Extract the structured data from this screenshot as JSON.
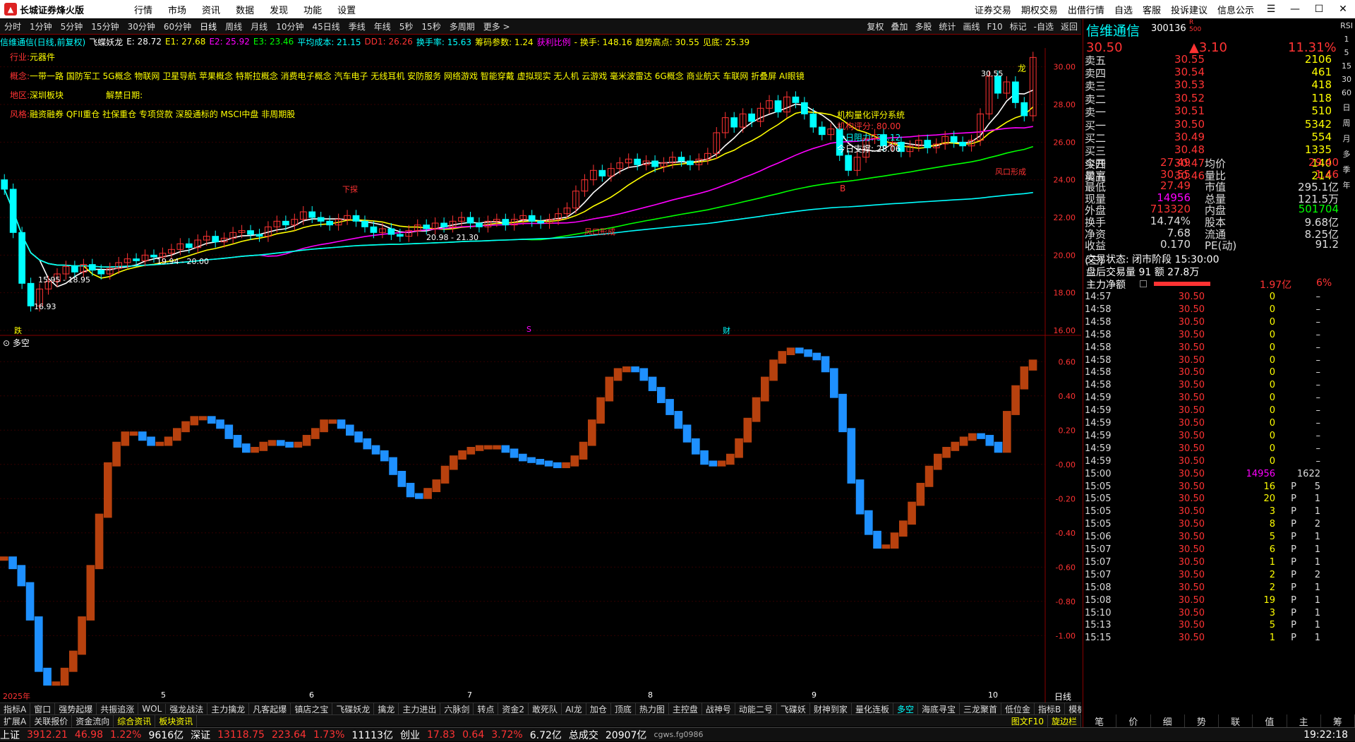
{
  "titlebar": {
    "app": "长城证券烽火版",
    "menus": [
      "行情",
      "市场",
      "资讯",
      "数据",
      "发现",
      "功能",
      "设置"
    ],
    "right": [
      "证券交易",
      "期权交易",
      "出借行情",
      "自选",
      "客服",
      "投诉建议",
      "信息公示"
    ]
  },
  "periods": [
    "分时",
    "1分钟",
    "5分钟",
    "15分钟",
    "30分钟",
    "60分钟",
    "日线",
    "周线",
    "月线",
    "10分钟",
    "45日线",
    "季线",
    "年线",
    "5秒",
    "15秒",
    "多周期",
    "更多 >"
  ],
  "toolbar_right": [
    "复权",
    "叠加",
    "多股",
    "统计",
    "画线",
    "F10",
    "标记",
    "-自选",
    "返回"
  ],
  "indicator_line": [
    {
      "t": "信维通信(日线,前复权)",
      "c": "ccya"
    },
    {
      "t": "飞蝶妖龙",
      "c": "cwht"
    },
    {
      "t": "E: 28.72",
      "c": "cwht"
    },
    {
      "t": "E1: 27.68",
      "c": "cyel"
    },
    {
      "t": "E2: 25.92",
      "c": "cmag"
    },
    {
      "t": "E3: 23.46",
      "c": "cgrn"
    },
    {
      "t": "平均成本: 21.15",
      "c": "ccya"
    },
    {
      "t": "DD1: 26.26",
      "c": "cred"
    },
    {
      "t": "换手率: 15.63",
      "c": "ccya"
    },
    {
      "t": "筹码参数: 1.24",
      "c": "cyel"
    },
    {
      "t": "获利比例",
      "c": "cmag"
    },
    {
      "t": "- 换手: 148.16",
      "c": "cyel"
    },
    {
      "t": "趋势高点: 30.55",
      "c": "cyel"
    },
    {
      "t": "见底: 25.39",
      "c": "cyel"
    }
  ],
  "info": {
    "industry_label": "行业:",
    "industry": "元器件",
    "concept_label": "概念:",
    "concepts": "一带一路 国防军工 5G概念 物联网 卫星导航 苹果概念 特斯拉概念 消费电子概念 汽车电子 无线耳机 安防服务 网络游戏 智能穿戴 虚拟现实 无人机 云游戏 毫米波雷达 6G概念 商业航天 车联网 折叠屏 AI眼镜",
    "region_label": "地区:",
    "region": "深圳板块",
    "unlock_label": "解禁日期:",
    "style_label": "风格:",
    "style": "融资融券 QFII重仓 社保重仓 专项贷款 深股通标的 MSCI中盘 非周期股"
  },
  "chart_labels": {
    "score_title": "机构量化评分系统",
    "score": "机构评分:  80.00",
    "resist": "今日阻力:  31.12",
    "support": "今日支撑:  28.06",
    "high_label": "30.55",
    "low_label": "16.93",
    "range1": "15.95 - 18.95",
    "range2": "19.94 - 20.00",
    "range3": "20.98 - 21.30",
    "wind1": "风口形成",
    "wind2": "风口形成",
    "down": "下探",
    "fall": "跌",
    "cai": "财",
    "s": "S",
    "B": "B",
    "dragon": "龙",
    "subtitle": "多空",
    "x_year": "2025年",
    "x_months": [
      "5",
      "6",
      "7",
      "8",
      "9",
      "10"
    ],
    "day_btn": "日线"
  },
  "price_axis": [
    "30.00",
    "28.00",
    "26.00",
    "24.00",
    "22.00",
    "20.00",
    "18.00",
    "16.00"
  ],
  "sub_axis": [
    "0.60",
    "0.40",
    "0.20",
    "-0.00",
    "-0.20",
    "-0.40",
    "-0.60",
    "-0.80",
    "-1.00"
  ],
  "quote": {
    "name": "信维通信",
    "code": "300136",
    "r": "R",
    "n": "500",
    "price": "30.50",
    "change": "▲3.10",
    "pct": "11.31%",
    "asks": [
      [
        "卖五",
        "30.55",
        "2106"
      ],
      [
        "卖四",
        "30.54",
        "461"
      ],
      [
        "卖三",
        "30.53",
        "418"
      ],
      [
        "卖二",
        "30.52",
        "118"
      ],
      [
        "卖一",
        "30.51",
        "510"
      ]
    ],
    "bids": [
      [
        "买一",
        "30.50",
        "5342"
      ],
      [
        "买二",
        "30.49",
        "554"
      ],
      [
        "买三",
        "30.48",
        "1335"
      ],
      [
        "买四",
        "30.47",
        "140"
      ],
      [
        "买五",
        "30.46",
        "214"
      ]
    ],
    "stats": [
      [
        "今开",
        "27.49",
        "均价",
        "29.40"
      ],
      [
        "最高",
        "30.55",
        "量比",
        "1.46"
      ],
      [
        "最低",
        "27.49",
        "市值",
        "295.1亿"
      ],
      [
        "现量",
        "14956",
        "总量",
        "121.5万"
      ],
      [
        "外盘",
        "713320",
        "内盘",
        "501704"
      ],
      [
        "换手",
        "14.74%",
        "股本",
        "9.68亿"
      ],
      [
        "净资",
        "7.68",
        "流通",
        "8.25亿"
      ],
      [
        "收益(三)",
        "0.170",
        "PE(动)",
        "91.2"
      ]
    ],
    "state": "交易状态: 闭市阶段 15:30:00",
    "after": "盘后交易量 91 额 27.8万",
    "flow_label": "主力净额",
    "flow": "1.97亿",
    "flow_pct": "6%"
  },
  "ticks": [
    [
      "14:57",
      "30.50",
      "0",
      "",
      "–"
    ],
    [
      "14:58",
      "30.50",
      "0",
      "",
      "–"
    ],
    [
      "14:58",
      "30.50",
      "0",
      "",
      "–"
    ],
    [
      "14:58",
      "30.50",
      "0",
      "",
      "–"
    ],
    [
      "14:58",
      "30.50",
      "0",
      "",
      "–"
    ],
    [
      "14:58",
      "30.50",
      "0",
      "",
      "–"
    ],
    [
      "14:58",
      "30.50",
      "0",
      "",
      "–"
    ],
    [
      "14:58",
      "30.50",
      "0",
      "",
      "–"
    ],
    [
      "14:59",
      "30.50",
      "0",
      "",
      "–"
    ],
    [
      "14:59",
      "30.50",
      "0",
      "",
      "–"
    ],
    [
      "14:59",
      "30.50",
      "0",
      "",
      "–"
    ],
    [
      "14:59",
      "30.50",
      "0",
      "",
      "–"
    ],
    [
      "14:59",
      "30.50",
      "0",
      "",
      "–"
    ],
    [
      "14:59",
      "30.50",
      "0",
      "",
      "–"
    ],
    [
      "15:00",
      "30.50",
      "14956",
      "",
      "1622"
    ],
    [
      "15:05",
      "30.50",
      "16",
      "P",
      "5"
    ],
    [
      "15:05",
      "30.50",
      "20",
      "P",
      "1"
    ],
    [
      "15:05",
      "30.50",
      "3",
      "P",
      "1"
    ],
    [
      "15:05",
      "30.50",
      "8",
      "P",
      "2"
    ],
    [
      "15:06",
      "30.50",
      "5",
      "P",
      "1"
    ],
    [
      "15:07",
      "30.50",
      "6",
      "P",
      "1"
    ],
    [
      "15:07",
      "30.50",
      "1",
      "P",
      "1"
    ],
    [
      "15:07",
      "30.50",
      "2",
      "P",
      "2"
    ],
    [
      "15:08",
      "30.50",
      "2",
      "P",
      "1"
    ],
    [
      "15:08",
      "30.50",
      "19",
      "P",
      "1"
    ],
    [
      "15:10",
      "30.50",
      "3",
      "P",
      "1"
    ],
    [
      "15:13",
      "30.50",
      "5",
      "P",
      "1"
    ],
    [
      "15:15",
      "30.50",
      "1",
      "P",
      "1"
    ]
  ],
  "bottom_tabs": [
    "指标A",
    "窗口",
    "强势起爆",
    "共振追涨",
    "WOL",
    "强龙战法",
    "主力擒龙",
    "凡客起爆",
    "镇店之宝",
    "飞碟妖龙",
    "擒龙",
    "主力进出",
    "六脉剑",
    "转点",
    "资金2",
    "敢死队",
    "AI龙",
    "加仓",
    "顶底",
    "热力图",
    "主控盘",
    "战神号",
    "动能二号",
    "飞碟妖",
    "财神到家",
    "量化连板",
    "多空",
    "海底寻宝",
    "三龙聚首",
    "低位金",
    "指标B",
    "模板"
  ],
  "bottom_tabs2": [
    "扩展A",
    "关联报价",
    "资金流向",
    "综合资讯",
    "板块资讯"
  ],
  "bottom_tabs2_right": [
    "图文F10",
    "旋边栏"
  ],
  "right_tabs": [
    "笔",
    "价",
    "细",
    "势",
    "联",
    "值",
    "主",
    "筹"
  ],
  "status": {
    "sh_label": "上证",
    "sh": "3912.21",
    "sh_ch": "46.98",
    "sh_pct": "1.22%",
    "sh_amt": "9616亿",
    "sz_label": "深证",
    "sz": "13118.75",
    "sz_ch": "223.64",
    "sz_pct": "1.73%",
    "sz_amt": "11113亿",
    "cy_label": "创业",
    "cy": "17.83",
    "cy_ch": "0.64",
    "cy_pct": "3.72%",
    "cy_amt": "6.72亿",
    "total_label": "总成交",
    "total": "20907亿",
    "user": "cgws.fg0986",
    "time": "19:22:18"
  },
  "sidebar": [
    "RSI",
    "1",
    "5",
    "15",
    "30",
    "60",
    "日",
    "周",
    "月",
    "多",
    "季",
    "年"
  ],
  "colors": {
    "up": "#ff3333",
    "down": "#00ffff",
    "mag": "#ff00ff",
    "yel": "#ffff00",
    "grn": "#00ff00",
    "bar_up": "#b7410e",
    "bar_dn": "#1e90ff"
  },
  "chart_data": [
    {
      "type": "candlestick",
      "title": "信维通信(日线,前复权)",
      "ylim": [
        16,
        31
      ],
      "y_ticks": [
        30,
        28,
        26,
        24,
        22,
        20,
        18,
        16
      ],
      "x_labels": [
        "2025年",
        "5",
        "6",
        "7",
        "8",
        "9",
        "10"
      ],
      "close": [
        23.5,
        21.2,
        18.5,
        17.3,
        18.2,
        18.6,
        19.0,
        19.4,
        19.1,
        19.5,
        19.2,
        19.0,
        19.3,
        19.6,
        19.8,
        19.7,
        20.0,
        19.9,
        20.1,
        20.3,
        20.6,
        20.4,
        20.8,
        21.0,
        20.7,
        20.9,
        21.2,
        21.3,
        21.1,
        21.0,
        21.5,
        21.8,
        21.6,
        21.9,
        22.3,
        22.0,
        21.8,
        21.6,
        21.9,
        22.1,
        21.8,
        21.5,
        21.2,
        21.4,
        21.1,
        21.0,
        21.3,
        21.6,
        21.4,
        21.7,
        21.5,
        21.8,
        22.0,
        21.7,
        21.5,
        21.8,
        21.9,
        21.6,
        21.9,
        22.1,
        21.8,
        21.7,
        21.9,
        22.2,
        22.5,
        23.4,
        24.0,
        24.5,
        24.2,
        24.6,
        24.9,
        25.1,
        24.8,
        25.0,
        24.7,
        24.9,
        25.2,
        25.0,
        24.8,
        25.1,
        25.4,
        26.5,
        27.3,
        26.8,
        27.5,
        27.1,
        27.8,
        28.2,
        27.6,
        28.4,
        28.1,
        27.5,
        26.8,
        26.4,
        26.7,
        25.3,
        24.5,
        25.2,
        26.2,
        26.4,
        25.8,
        26.0,
        25.5,
        25.8,
        26.1,
        25.7,
        25.9,
        26.3,
        26.0,
        25.8,
        26.1,
        27.5,
        29.5,
        28.6,
        29.2,
        28.1,
        27.4,
        30.5
      ]
    },
    {
      "type": "bar",
      "title": "多空",
      "ylim": [
        -1.3,
        0.7
      ],
      "y_ticks": [
        0.6,
        0.4,
        0.2,
        0.0,
        -0.2,
        -0.4,
        -0.6,
        -0.8,
        -1.0
      ],
      "values": [
        -0.55,
        -0.6,
        -0.7,
        -0.9,
        -1.2,
        -1.28,
        -1.28,
        -1.2,
        -1.1,
        -0.9,
        -0.6,
        -0.3,
        0.0,
        0.12,
        0.18,
        0.18,
        0.15,
        0.12,
        0.12,
        0.15,
        0.2,
        0.24,
        0.27,
        0.27,
        0.25,
        0.22,
        0.16,
        0.11,
        0.08,
        0.09,
        0.12,
        0.13,
        0.12,
        0.11,
        0.12,
        0.16,
        0.2,
        0.25,
        0.25,
        0.22,
        0.18,
        0.14,
        0.1,
        0.07,
        0.03,
        -0.05,
        -0.12,
        -0.18,
        -0.19,
        -0.15,
        -0.1,
        -0.02,
        0.04,
        0.07,
        0.09,
        0.1,
        0.1,
        0.1,
        0.08,
        0.05,
        0.03,
        0.02,
        0.01,
        0.0,
        -0.01,
        0.0,
        0.04,
        0.12,
        0.25,
        0.38,
        0.5,
        0.55,
        0.56,
        0.55,
        0.5,
        0.44,
        0.37,
        0.3,
        0.22,
        0.14,
        0.07,
        0.01,
        0.0,
        0.01,
        0.05,
        0.14,
        0.26,
        0.38,
        0.5,
        0.6,
        0.65,
        0.67,
        0.66,
        0.64,
        0.62,
        0.55,
        0.4,
        0.2,
        -0.1,
        -0.28,
        -0.4,
        -0.48,
        -0.48,
        -0.41,
        -0.34,
        -0.23,
        -0.12,
        -0.02,
        0.05,
        0.09,
        0.12,
        0.15,
        0.17,
        0.16,
        0.12,
        0.08,
        0.3,
        0.45,
        0.56,
        0.6
      ]
    }
  ]
}
